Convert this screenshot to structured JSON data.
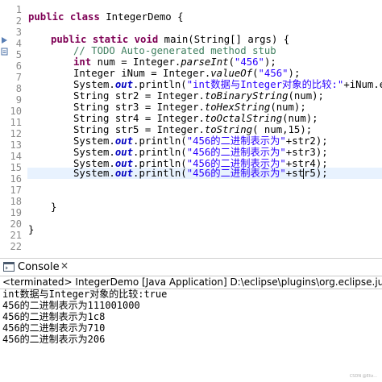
{
  "colors": {
    "keyword": "#7f0055",
    "comment": "#3f7f5f",
    "string": "#2a00ff",
    "field": "#0000c0",
    "line_number": "#8a8a8a",
    "current_line_highlight": "#e8f2fe"
  },
  "editor": {
    "line_numbers": [
      "1",
      "2",
      "3",
      "4",
      "5",
      "6",
      "7",
      "8",
      "9",
      "10",
      "11",
      "12",
      "13",
      "14",
      "15",
      "16",
      "17",
      "18",
      "19",
      "20",
      "21",
      "22"
    ],
    "class_decl": {
      "kw1": "public",
      "kw2": "class",
      "name": " IntegerDemo {"
    },
    "main_decl": {
      "kw1": "public",
      "kw2": "static",
      "kw3": "void",
      "rest": " main(String[] args) {"
    },
    "todo_comment": "// TODO Auto-generated method stub",
    "line_num": {
      "kw": "int",
      "pre": " num = Integer.",
      "method": "parseInt",
      "open": "(",
      "str": "\"456\"",
      "close": ");"
    },
    "line_inum": {
      "pre": "Integer iNum = Integer.",
      "method": "valueOf",
      "open": "(",
      "str": "\"456\"",
      "close": ");"
    },
    "line_eq": {
      "pre": "System.",
      "field": "out",
      "mid": ".println(",
      "str": "\"int数据与Integer对象的比较:\"",
      "rest": "+iNum.equals"
    },
    "conv_lines": [
      {
        "pre": "String str2 = Integer.",
        "method": "toBinaryString",
        "post": "(num);"
      },
      {
        "pre": "String str3 = Integer.",
        "method": "toHexString",
        "post": "(num);"
      },
      {
        "pre": "String str4 = Integer.",
        "method": "toOctalString",
        "post": "(num);"
      },
      {
        "pre": "String str5 = Integer.",
        "method": "toString",
        "post": "( num,15);"
      }
    ],
    "print_lines": [
      {
        "pre": "System.",
        "field": "out",
        "mid": ".println(",
        "str": "\"456的二进制表示为\"",
        "post": "+str2);"
      },
      {
        "pre": "System.",
        "field": "out",
        "mid": ".println(",
        "str": "\"456的二进制表示为\"",
        "post": "+str3);"
      },
      {
        "pre": "System.",
        "field": "out",
        "mid": ".println(",
        "str": "\"456的二进制表示为\"",
        "post": "+str4);"
      },
      {
        "pre": "System.",
        "field": "out",
        "mid": ".println(",
        "str": "\"456的二进制表示为\"",
        "post": "+str5);"
      }
    ],
    "close_method": "}",
    "close_class": "}"
  },
  "console": {
    "tab_label": "Console",
    "close_glyph": "✕",
    "icon": "console-icon",
    "status": "<terminated> IntegerDemo [Java Application] D:\\eclipse\\plugins\\org.eclipse.justj.openjdk.hotspo",
    "output": [
      "int数据与Integer对象的比较:true",
      "456的二进制表示为111001000",
      "456的二进制表示为1c8",
      "456的二进制表示为710",
      "456的二进制表示为206"
    ]
  },
  "watermark": "CSDN @Eliz..."
}
